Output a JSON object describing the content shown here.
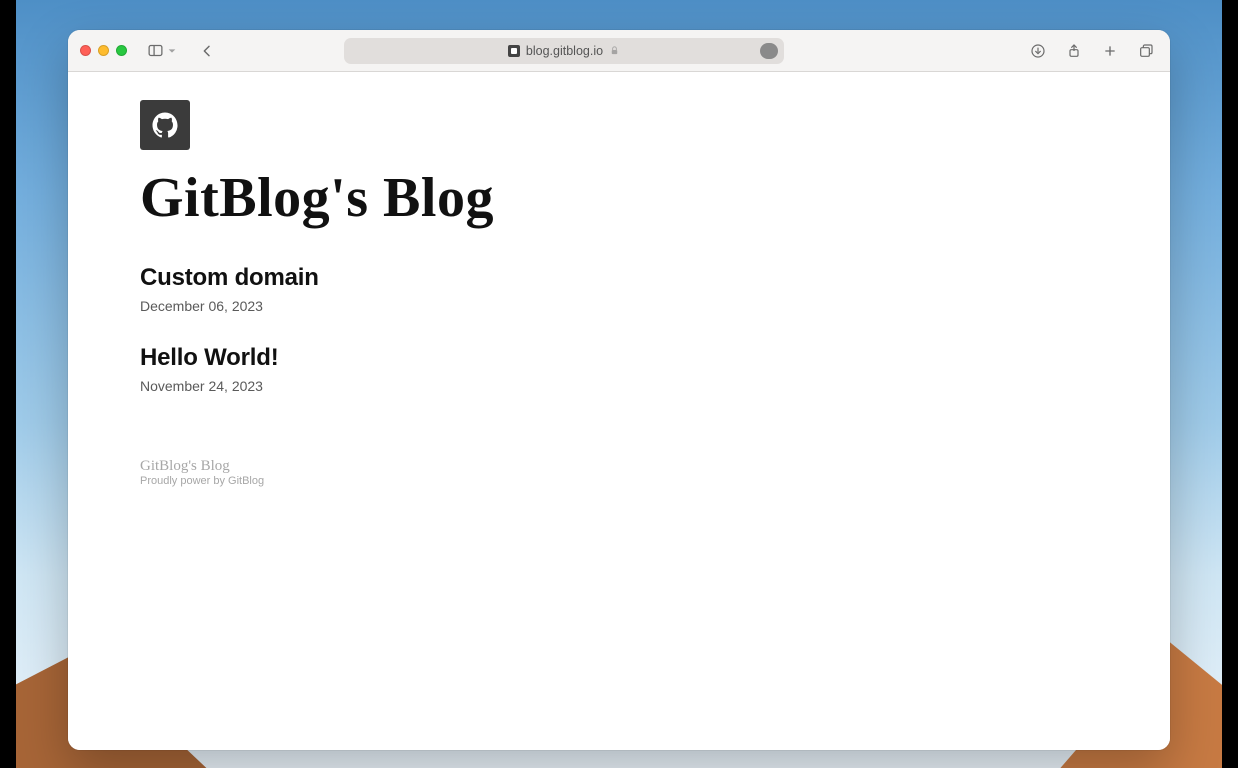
{
  "browser": {
    "url_display": "blog.gitblog.io"
  },
  "blog": {
    "title": "GitBlog's Blog",
    "posts": [
      {
        "title": "Custom domain",
        "date": "December 06, 2023"
      },
      {
        "title": "Hello World!",
        "date": "November 24, 2023"
      }
    ],
    "footer": {
      "title": "GitBlog's Blog",
      "credit": "Proudly power by GitBlog"
    }
  }
}
